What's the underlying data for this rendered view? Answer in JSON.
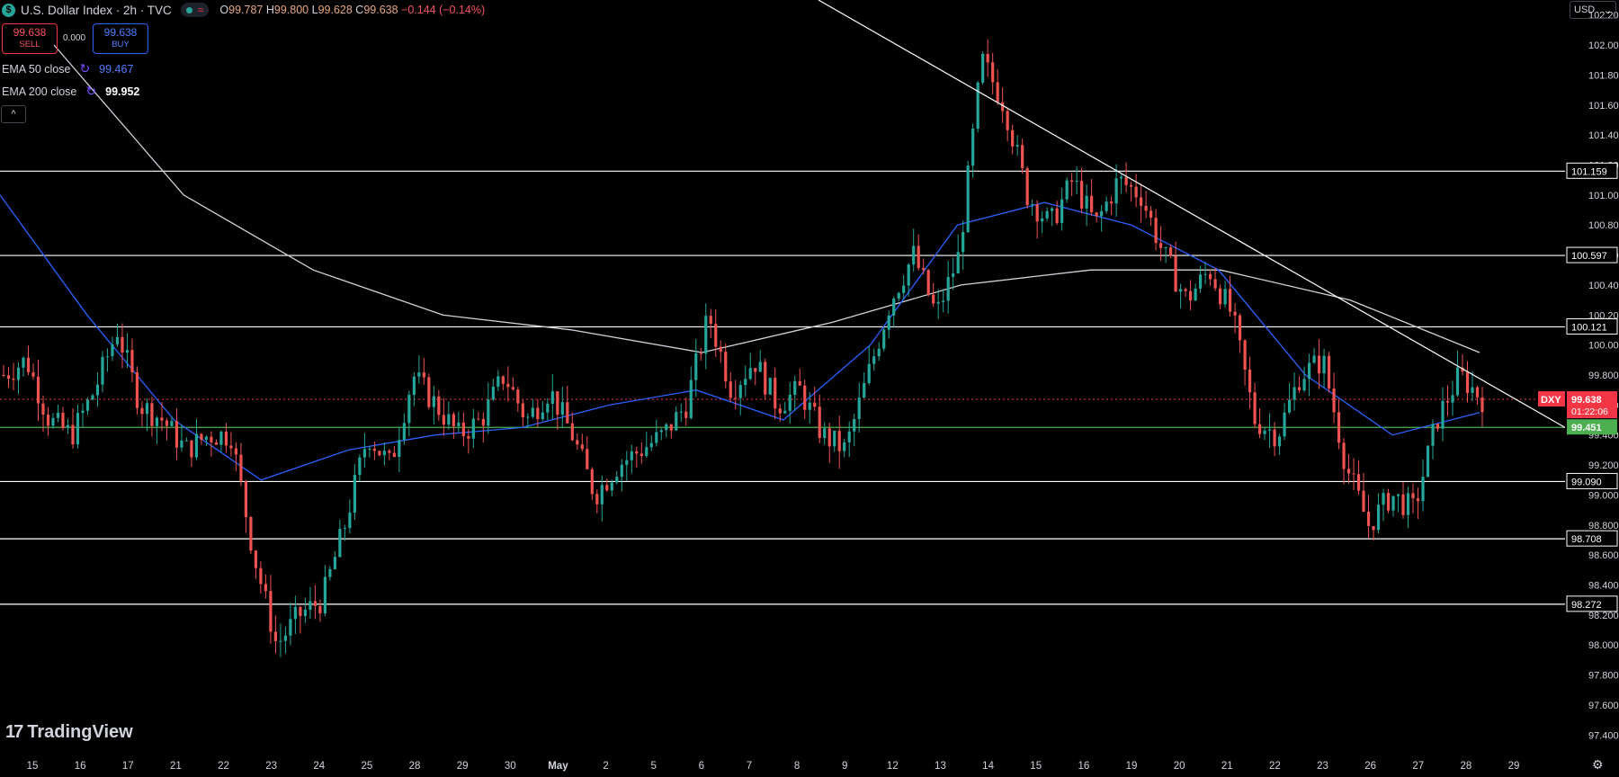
{
  "header": {
    "logo_symbol": "$",
    "title": "U.S. Dollar Index · 2h · TVC",
    "wave_icon": "≈",
    "ohlc": {
      "o_label": "O",
      "o": "99.787",
      "h_label": "H",
      "h": "99.800",
      "l_label": "L",
      "l": "99.628",
      "c_label": "C",
      "c": "99.638",
      "change": "−0.144 (−0.14%)"
    }
  },
  "trade": {
    "sell_price": "99.638",
    "sell_label": "SELL",
    "spread": "0.000",
    "buy_price": "99.638",
    "buy_label": "BUY"
  },
  "indicators": {
    "ema50_label": "EMA 50 close",
    "ema50_value": "99.467",
    "ema200_label": "EMA 200 close",
    "ema200_value": "99.952"
  },
  "collapse_glyph": "^",
  "currency": {
    "label": "USD",
    "chevron": "⌄"
  },
  "brand": {
    "mark": "17",
    "name": "TradingView"
  },
  "settings_icon": "⚙",
  "colors": {
    "up": "#26a69a",
    "down": "#ef5350",
    "ema50": "#2962ff",
    "ema200": "#d1d4dc",
    "support_green": "#4caf50",
    "price_red": "#f23645"
  },
  "chart_data": {
    "type": "candlestick",
    "symbol": "DXY",
    "ylim": [
      97.3,
      102.3
    ],
    "y_ticks": [
      "97.400",
      "97.600",
      "97.800",
      "98.000",
      "98.200",
      "98.400",
      "98.600",
      "98.800",
      "99.000",
      "99.200",
      "99.400",
      "99.600",
      "99.800",
      "100.000",
      "100.200",
      "100.400",
      "100.600",
      "100.800",
      "101.000",
      "101.200",
      "101.400",
      "101.600",
      "101.800",
      "102.000",
      "102.200"
    ],
    "x_ticks": [
      "15",
      "16",
      "17",
      "21",
      "22",
      "23",
      "24",
      "25",
      "28",
      "29",
      "30",
      "May",
      "2",
      "5",
      "6",
      "7",
      "8",
      "9",
      "12",
      "13",
      "14",
      "15",
      "16",
      "19",
      "20",
      "21",
      "22",
      "23",
      "26",
      "27",
      "28",
      "29"
    ],
    "horizontal_levels": [
      "101.159",
      "100.597",
      "100.121",
      "99.090",
      "98.708",
      "98.272"
    ],
    "support_level": "99.451",
    "last_price": "99.638",
    "countdown": "01:22:06",
    "candle_path": [
      99.8,
      99.9,
      99.5,
      99.4,
      99.7,
      100.1,
      99.6,
      99.5,
      99.3,
      99.4,
      99.4,
      98.6,
      98.0,
      98.2,
      98.3,
      98.8,
      99.4,
      99.2,
      99.8,
      99.6,
      99.4,
      99.5,
      99.8,
      99.5,
      99.7,
      99.4,
      99.0,
      99.2,
      99.3,
      99.4,
      99.6,
      100.2,
      99.7,
      99.9,
      99.6,
      99.7,
      99.4,
      99.3,
      99.8,
      100.3,
      100.6,
      100.2,
      100.6,
      101.9,
      101.6,
      101.0,
      100.8,
      101.1,
      100.8,
      101.1,
      101.0,
      100.6,
      100.3,
      100.5,
      100.2,
      99.5,
      99.4,
      99.8,
      99.9,
      99.2,
      98.8,
      99.0,
      98.9,
      99.5,
      99.8,
      99.64
    ],
    "ema50": [
      101.0,
      100.2,
      99.5,
      99.1,
      99.3,
      99.4,
      99.45,
      99.6,
      99.7,
      99.5,
      100.0,
      100.8,
      100.95,
      100.8,
      100.5,
      99.8,
      99.4,
      99.55
    ],
    "ema200": [
      102.0,
      101.0,
      100.5,
      100.2,
      100.1,
      99.95,
      100.15,
      100.4,
      100.5,
      100.5,
      100.3,
      99.95
    ],
    "trendline": [
      102.3,
      99.45
    ],
    "grid": false
  }
}
